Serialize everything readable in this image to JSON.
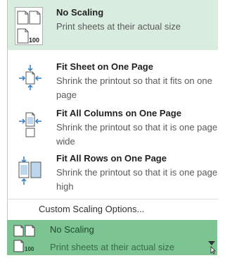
{
  "menu": {
    "options": [
      {
        "title": "No Scaling",
        "description": "Print sheets at their actual size",
        "icon_name": "no-scaling-icon",
        "icon_text": "100",
        "selected": true
      },
      {
        "title": "Fit Sheet on One Page",
        "description": "Shrink the printout so that it fits on one page",
        "icon_name": "fit-sheet-icon",
        "selected": false
      },
      {
        "title": "Fit All Columns on One Page",
        "description": "Shrink the printout so that it is one page wide",
        "icon_name": "fit-columns-icon",
        "selected": false
      },
      {
        "title": "Fit All Rows on One Page",
        "description": "Shrink the printout so that it is one page high",
        "icon_name": "fit-rows-icon",
        "selected": false
      }
    ],
    "custom_label": "Custom Scaling Options..."
  },
  "dropdown": {
    "title": "No Scaling",
    "description": "Print sheets at their actual size",
    "icon_text": "100",
    "icon_name": "no-scaling-icon",
    "arrow_icon": "dropdown-arrow-icon"
  },
  "colors": {
    "selected_bg": "#d8ecdf",
    "bar_bg": "#7cc592",
    "accent_blue": "#2e7cc4"
  }
}
